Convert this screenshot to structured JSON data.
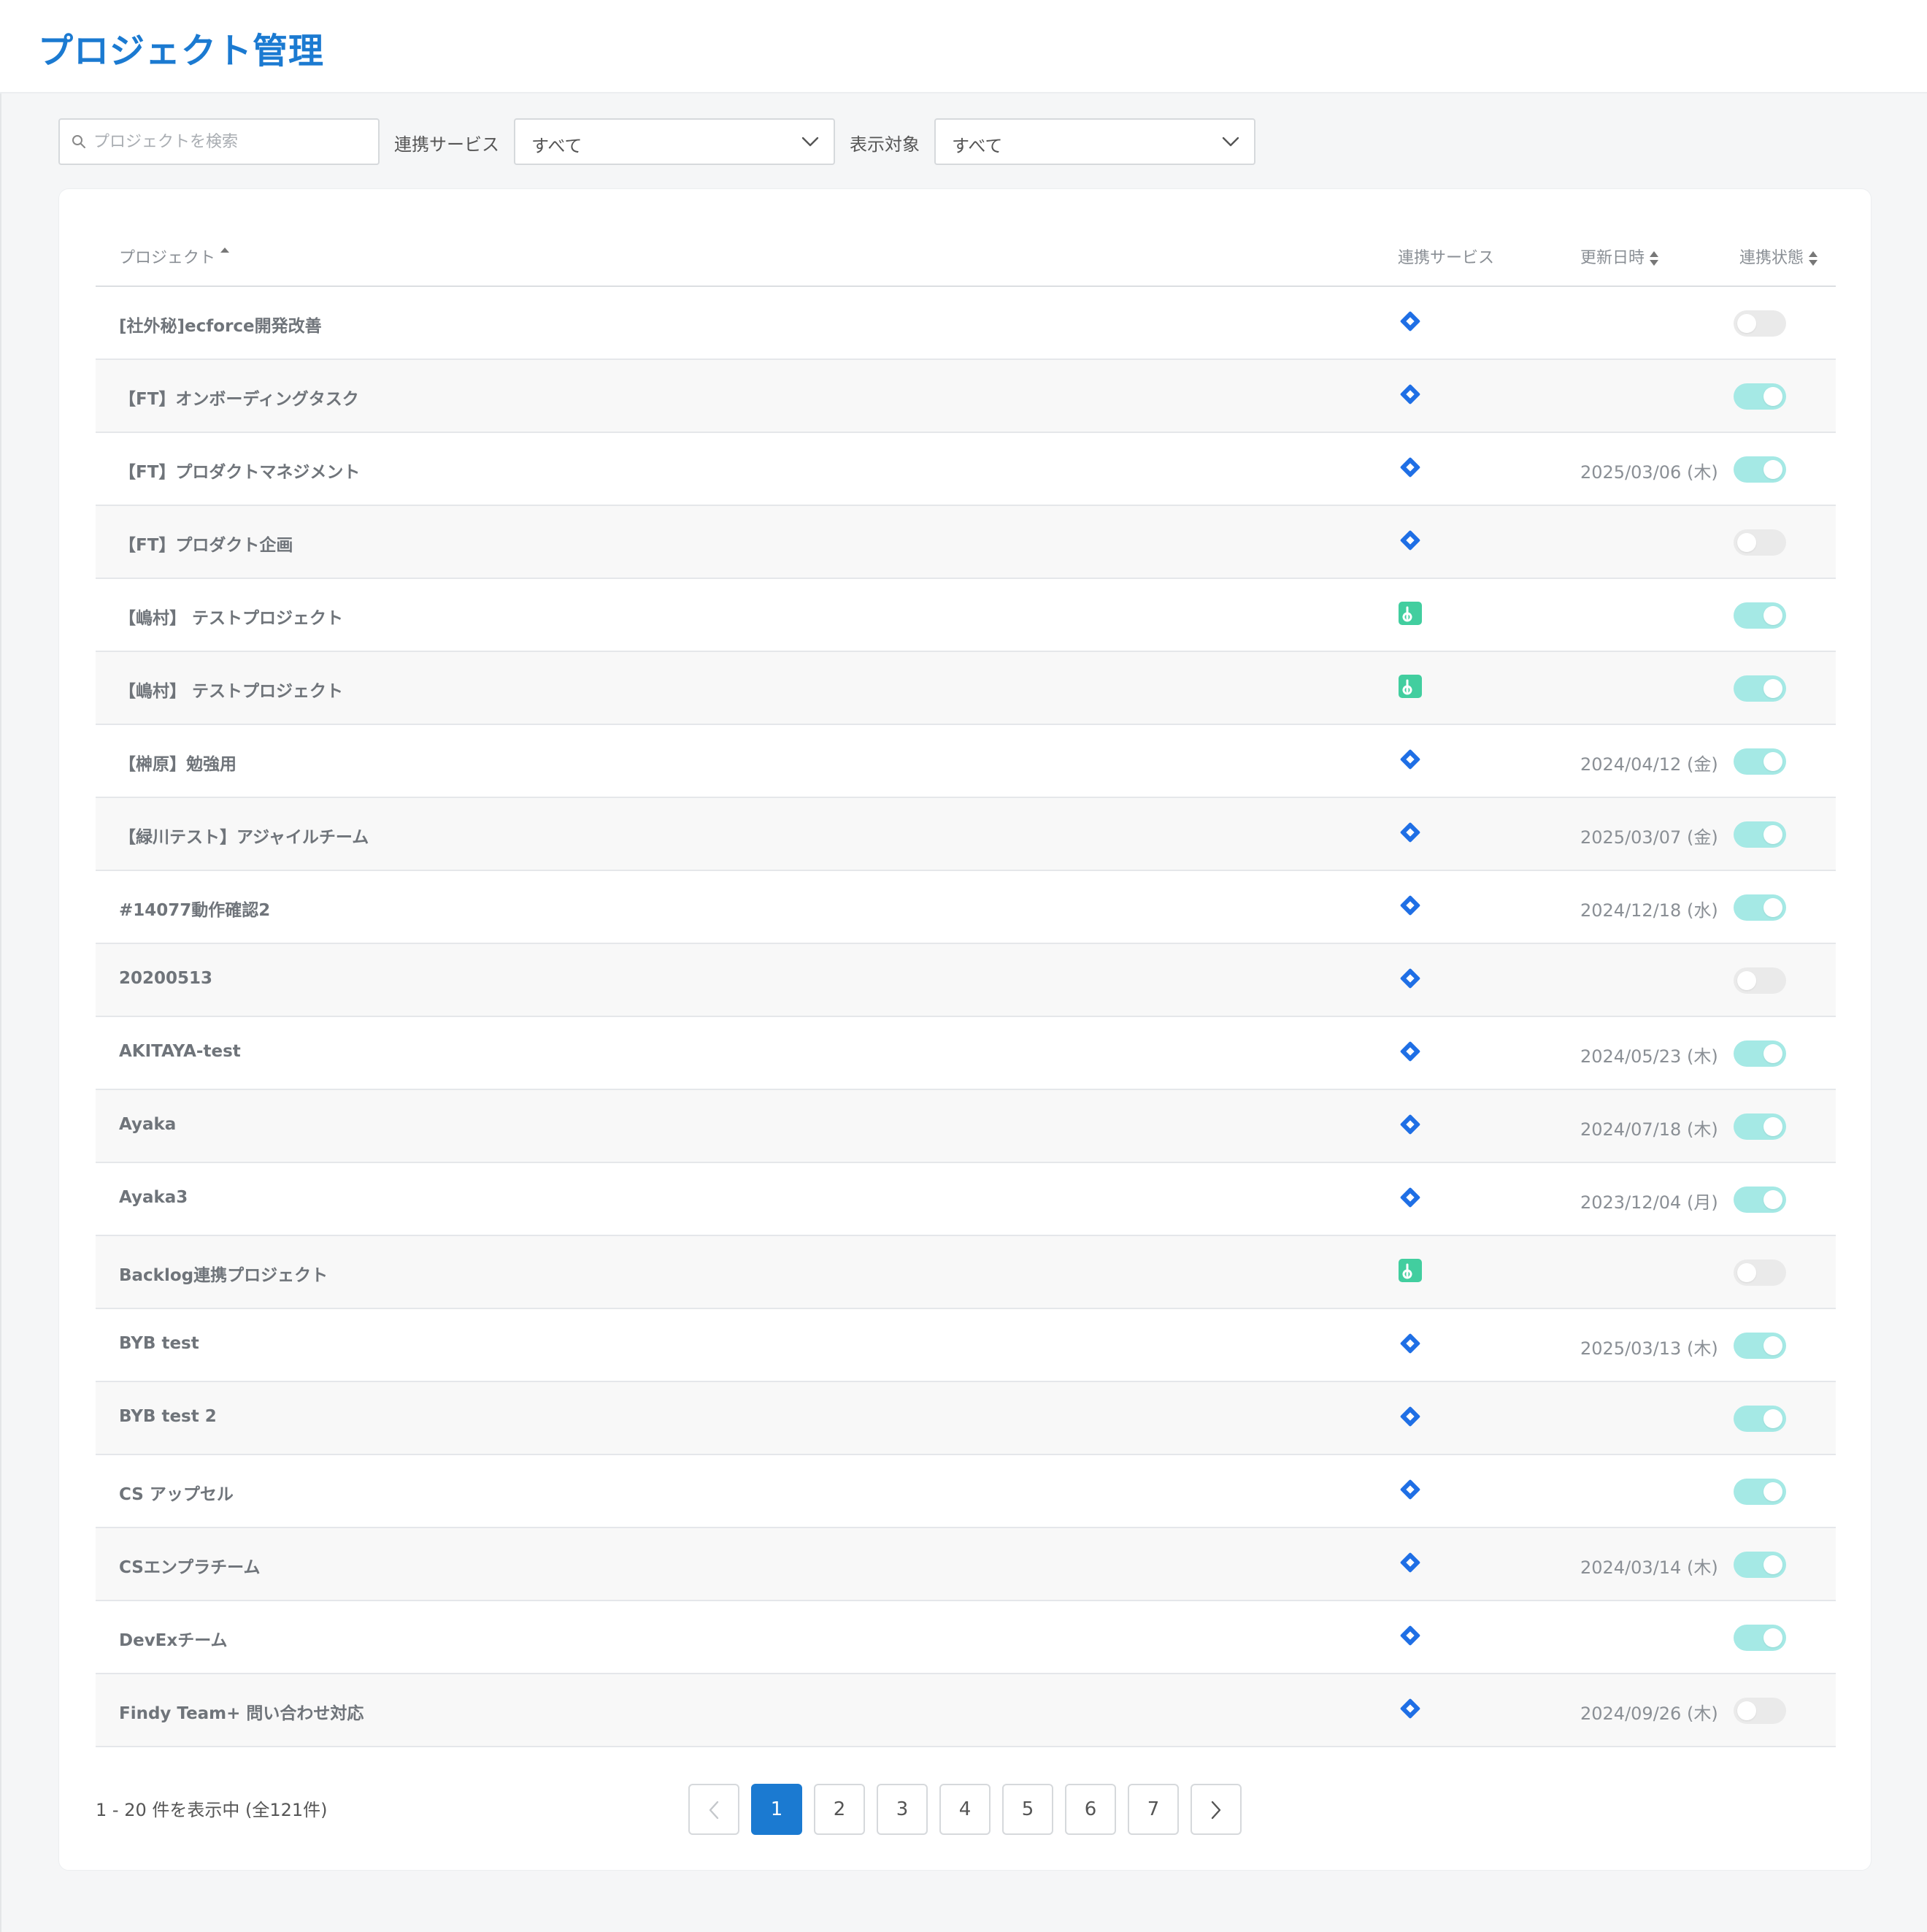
{
  "header": {
    "title": "プロジェクト管理"
  },
  "filters": {
    "search_placeholder": "プロジェクトを検索",
    "service_label": "連携サービス",
    "service_value": "すべて",
    "target_label": "表示対象",
    "target_value": "すべて"
  },
  "table": {
    "columns": {
      "project": "プロジェクト",
      "service": "連携サービス",
      "updated": "更新日時",
      "status": "連携状態"
    },
    "rows": [
      {
        "name": "[社外秘]ecforce開発改善",
        "service": "jira",
        "date": "",
        "enabled": false
      },
      {
        "name": "【FT】オンボーディングタスク",
        "service": "jira",
        "date": "",
        "enabled": true
      },
      {
        "name": "【FT】プロダクトマネジメント",
        "service": "jira",
        "date": "2025/03/06 (木)",
        "enabled": true
      },
      {
        "name": "【FT】プロダクト企画",
        "service": "jira",
        "date": "",
        "enabled": false
      },
      {
        "name": "【嶋村】 テストプロジェクト",
        "service": "backlog",
        "date": "",
        "enabled": true
      },
      {
        "name": "【嶋村】 テストプロジェクト",
        "service": "backlog",
        "date": "",
        "enabled": true
      },
      {
        "name": "【榊原】勉強用",
        "service": "jira",
        "date": "2024/04/12 (金)",
        "enabled": true
      },
      {
        "name": "【緑川テスト】アジャイルチーム",
        "service": "jira",
        "date": "2025/03/07 (金)",
        "enabled": true
      },
      {
        "name": "#14077動作確認2",
        "service": "jira",
        "date": "2024/12/18 (水)",
        "enabled": true
      },
      {
        "name": "20200513",
        "service": "jira",
        "date": "",
        "enabled": false
      },
      {
        "name": "AKITAYA-test",
        "service": "jira",
        "date": "2024/05/23 (木)",
        "enabled": true
      },
      {
        "name": "Ayaka",
        "service": "jira",
        "date": "2024/07/18 (木)",
        "enabled": true
      },
      {
        "name": "Ayaka3",
        "service": "jira",
        "date": "2023/12/04 (月)",
        "enabled": true
      },
      {
        "name": "Backlog連携プロジェクト",
        "service": "backlog",
        "date": "",
        "enabled": false
      },
      {
        "name": "BYB test",
        "service": "jira",
        "date": "2025/03/13 (木)",
        "enabled": true
      },
      {
        "name": "BYB test 2",
        "service": "jira",
        "date": "",
        "enabled": true
      },
      {
        "name": "CS アップセル",
        "service": "jira",
        "date": "",
        "enabled": true
      },
      {
        "name": "CSエンプラチーム",
        "service": "jira",
        "date": "2024/03/14 (木)",
        "enabled": true
      },
      {
        "name": "DevExチーム",
        "service": "jira",
        "date": "",
        "enabled": true
      },
      {
        "name": "Findy Team+ 問い合わせ対応",
        "service": "jira",
        "date": "2024/09/26 (木)",
        "enabled": false
      }
    ]
  },
  "footer": {
    "count_text": "1 - 20 件を表示中 (全121件)",
    "pages": [
      "1",
      "2",
      "3",
      "4",
      "5",
      "6",
      "7"
    ],
    "current_page": "1"
  },
  "colors": {
    "accent": "#1b7ad1",
    "jira": "#1f6fe5",
    "backlog": "#42ce9f",
    "toggle_on": "#a5e9e5",
    "toggle_off": "#eaeaea"
  }
}
